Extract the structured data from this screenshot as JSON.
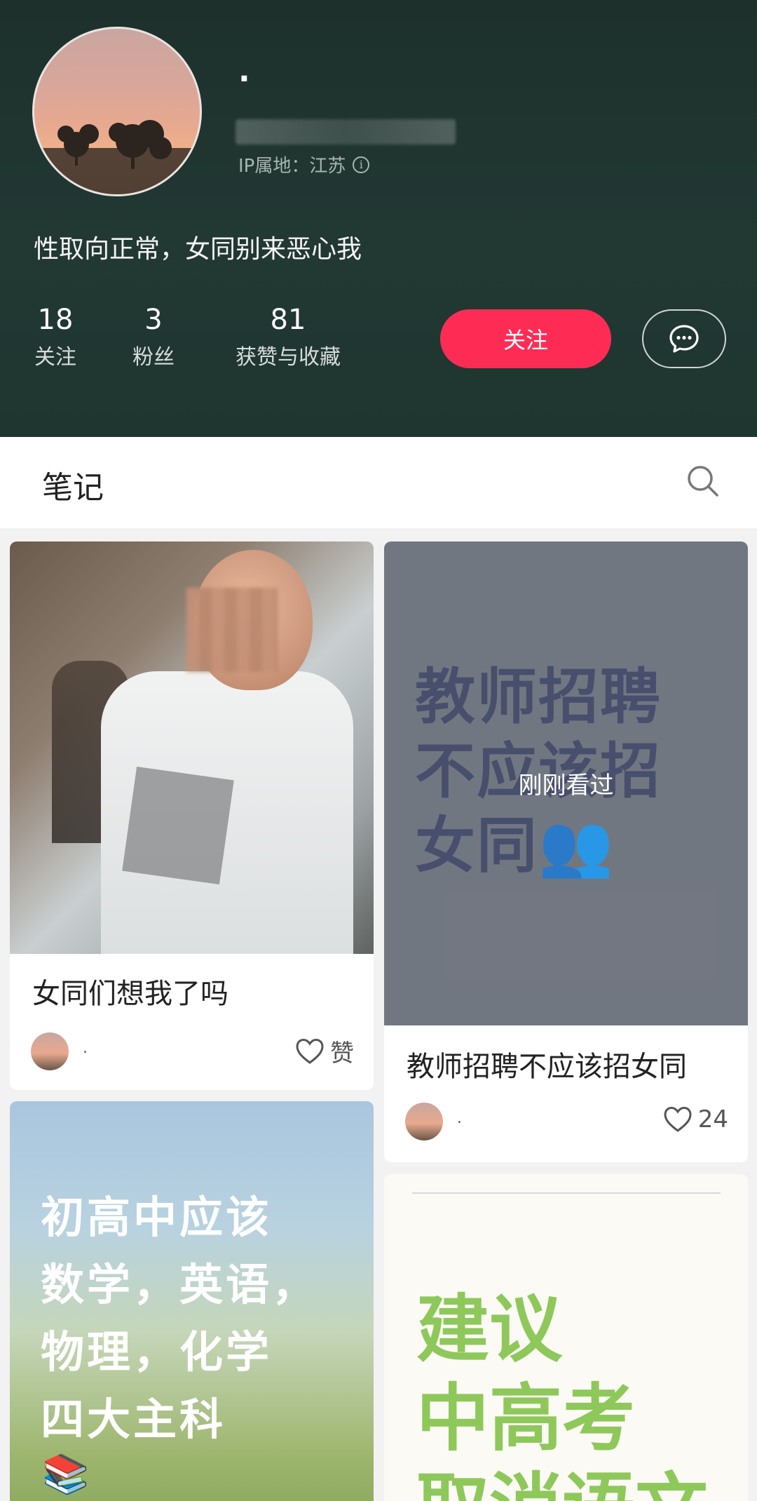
{
  "profile": {
    "nickname": ".",
    "ip_label": "IP属地：江苏",
    "bio": "性取向正常，女同别来恶心我",
    "stats": {
      "following": {
        "num": "18",
        "label": "关注"
      },
      "fans": {
        "num": "3",
        "label": "粉丝"
      },
      "likes": {
        "num": "81",
        "label": "获赞与收藏"
      }
    },
    "follow_label": "关注",
    "icons": {
      "info": "info-circle-icon",
      "message": "chat-bubble-icon"
    },
    "accent_color": "#fe2c55"
  },
  "tabs": {
    "notes_label": "笔记",
    "search_icon": "search-icon"
  },
  "notes": [
    {
      "title": "女同们想我了吗",
      "author": ".",
      "like_text": "赞"
    },
    {
      "title": "教师招聘不应该招女同",
      "author": ".",
      "like_text": "24",
      "cover_text": [
        "教师招聘",
        "不应该招",
        "女同"
      ],
      "cover_emoji": "👥",
      "overlay": "刚刚看过"
    },
    {
      "cover_text": [
        "初高中应该",
        "数学，英语，",
        "物理，化学",
        "四大主科"
      ],
      "cover_emoji": "📚"
    },
    {
      "cover_text": [
        "建议",
        "中高考",
        "取消语文"
      ]
    }
  ]
}
